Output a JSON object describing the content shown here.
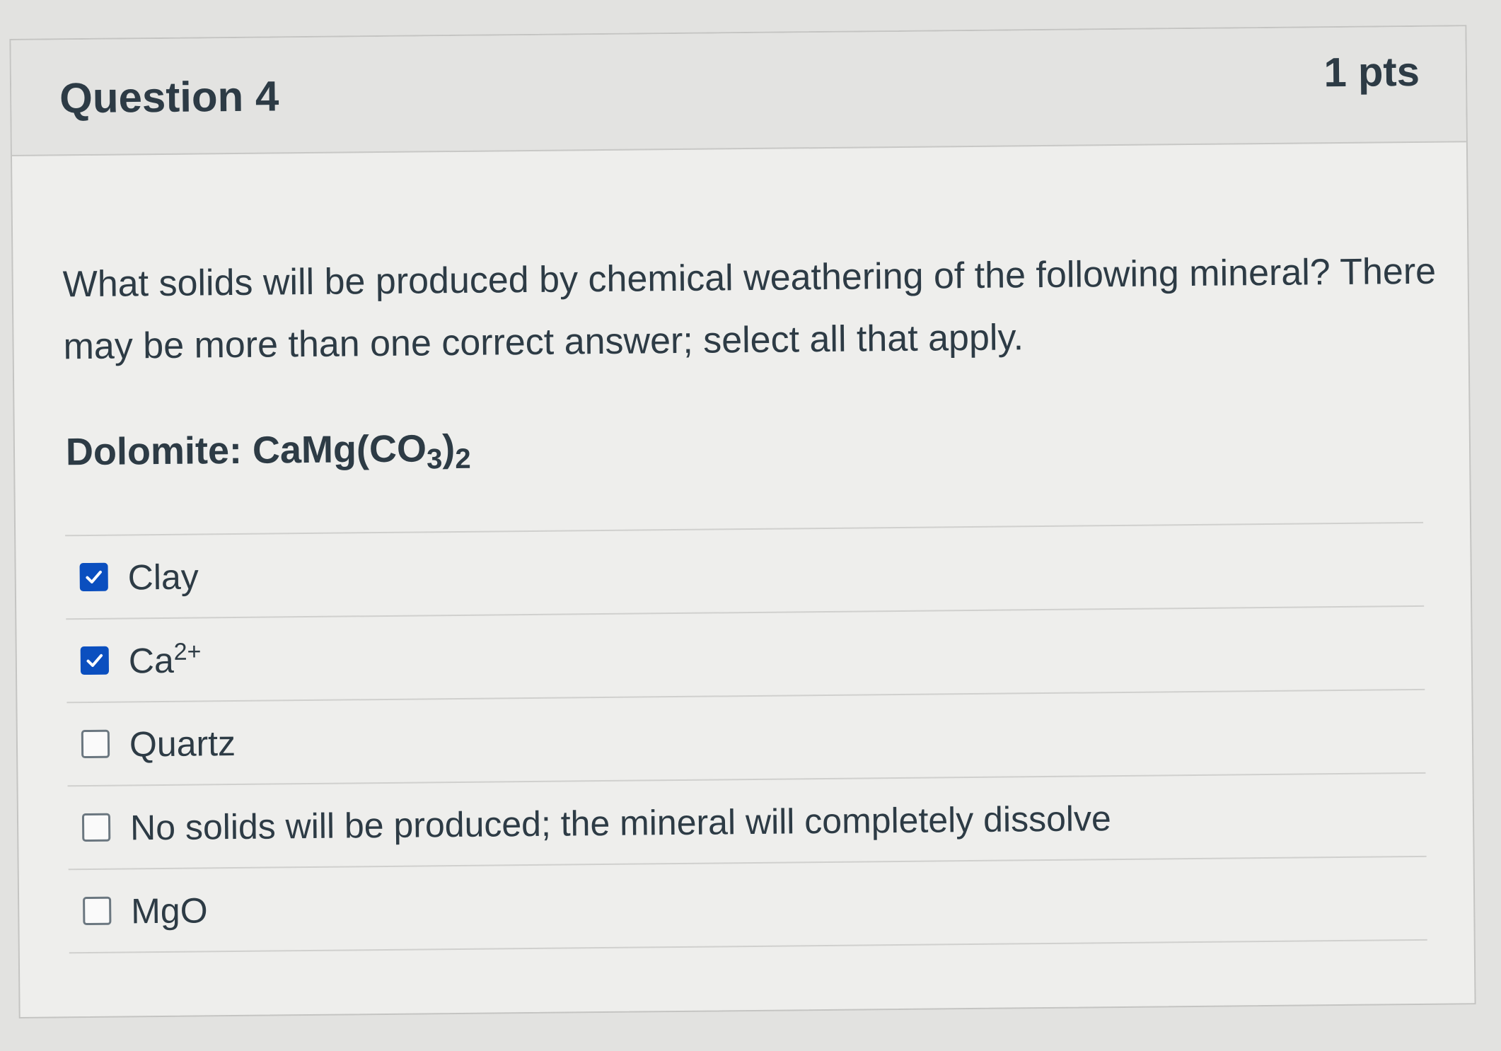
{
  "question": {
    "title": "Question 4",
    "points": "1 pts",
    "text": "What solids will be produced by chemical weathering of the following mineral? There may be more than one correct answer; select all that apply.",
    "mineral": {
      "label": "Dolomite: CaMg(CO",
      "sub1": "3",
      "paren": ")",
      "sub2": "2"
    }
  },
  "answers": [
    {
      "label": "Clay",
      "sup": "",
      "checked": true
    },
    {
      "label": "Ca",
      "sup": "2+",
      "checked": true
    },
    {
      "label": "Quartz",
      "sup": "",
      "checked": false
    },
    {
      "label": "No solids will be produced; the mineral will completely dissolve",
      "sup": "",
      "checked": false
    },
    {
      "label": "MgO",
      "sup": "",
      "checked": false
    }
  ],
  "colors": {
    "accent": "#0b4fbf",
    "text": "#2d3b45"
  }
}
